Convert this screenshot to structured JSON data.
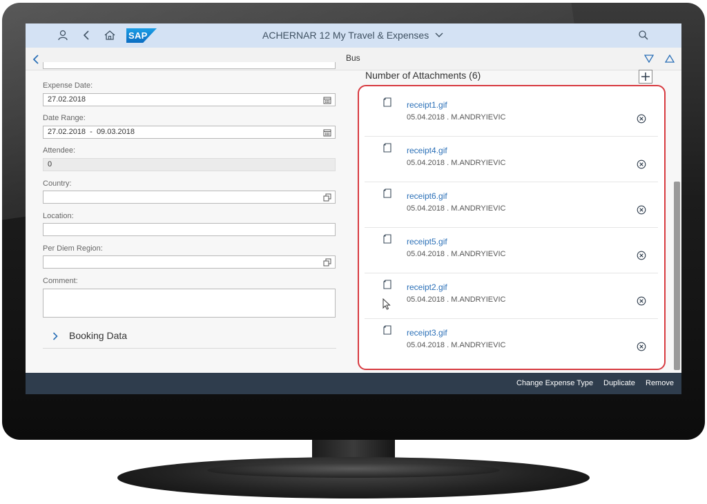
{
  "shellbar": {
    "title": "ACHERNAR 12 My Travel & Expenses",
    "logo_text": "SAP",
    "icons": [
      "user-icon",
      "back-icon",
      "home-icon",
      "search-icon"
    ]
  },
  "subheader": {
    "title": "Bus",
    "icons": [
      "nav-back-icon",
      "down-icon",
      "up-icon"
    ]
  },
  "form": {
    "expense_date": {
      "label": "Expense Date:",
      "value": "27.02.2018"
    },
    "date_range": {
      "label": "Date Range:",
      "value": "27.02.2018  -  09.03.2018"
    },
    "attendee": {
      "label": "Attendee:",
      "value": "0"
    },
    "country": {
      "label": "Country:",
      "value": ""
    },
    "location": {
      "label": "Location:",
      "value": ""
    },
    "per_diem_region": {
      "label": "Per Diem Region:",
      "value": ""
    },
    "comment": {
      "label": "Comment:",
      "value": ""
    }
  },
  "booking": {
    "label": "Booking Data"
  },
  "attachments": {
    "header": "Number of Attachments (6)",
    "items": [
      {
        "name": "receipt1.gif",
        "meta": "05.04.2018 . M.ANDRYIEVIC"
      },
      {
        "name": "receipt4.gif",
        "meta": "05.04.2018 . M.ANDRYIEVIC"
      },
      {
        "name": "receipt6.gif",
        "meta": "05.04.2018 . M.ANDRYIEVIC"
      },
      {
        "name": "receipt5.gif",
        "meta": "05.04.2018 . M.ANDRYIEVIC"
      },
      {
        "name": "receipt2.gif",
        "meta": "05.04.2018 . M.ANDRYIEVIC"
      },
      {
        "name": "receipt3.gif",
        "meta": "05.04.2018 . M.ANDRYIEVIC"
      }
    ]
  },
  "footer": {
    "change_type": "Change Expense Type",
    "duplicate": "Duplicate",
    "remove": "Remove"
  },
  "colors": {
    "shellbar_bg": "#d4e2f4",
    "footer_bg": "#2f3d4d",
    "link": "#2a6fb7",
    "highlight_border": "#d7393f"
  }
}
